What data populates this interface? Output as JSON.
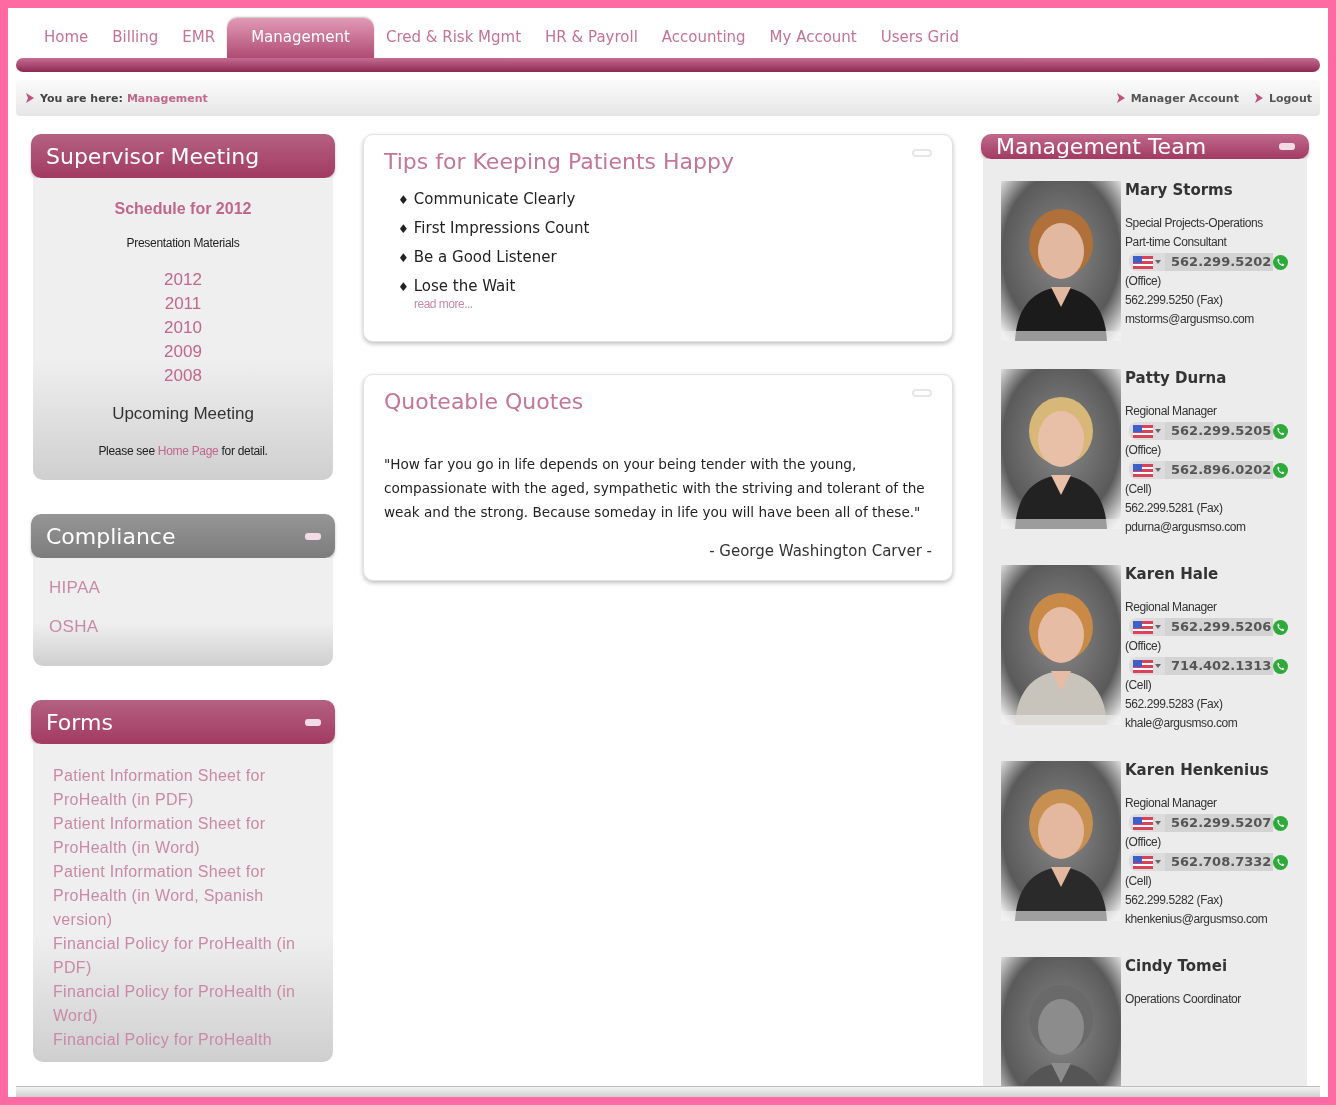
{
  "nav": {
    "tabs": [
      {
        "label": "Home",
        "selected": false
      },
      {
        "label": "Billing",
        "selected": false
      },
      {
        "label": "EMR",
        "selected": false
      },
      {
        "label": "Management",
        "selected": true
      },
      {
        "label": "Cred & Risk Mgmt",
        "selected": false
      },
      {
        "label": "HR & Payroll",
        "selected": false
      },
      {
        "label": "Accounting",
        "selected": false
      },
      {
        "label": "My Account",
        "selected": false
      },
      {
        "label": "Users Grid",
        "selected": false
      }
    ]
  },
  "breadcrumb": {
    "prefix": "You are here:",
    "current": "Management",
    "links": [
      "Manager Account",
      "Logout"
    ]
  },
  "left_panels": [
    {
      "kind": "meeting",
      "title": "Supervisor Meeting",
      "color": "#a23a62",
      "collapsible": false,
      "schedule_title": "Schedule for 2012",
      "materials_label": "Presentation Materials",
      "years": [
        "2012",
        "2011",
        "2010",
        "2009",
        "2008"
      ],
      "upcoming_title": "Upcoming Meeting",
      "detail": {
        "before": "Please see",
        "link": "Home Page",
        "after": "for detail."
      }
    },
    {
      "kind": "links",
      "title": "Compliance",
      "color": "#7c7c7c",
      "collapsible": true,
      "links": [
        "HIPAA",
        "OSHA"
      ]
    },
    {
      "kind": "links",
      "title": "Forms",
      "color": "#a23a62",
      "collapsible": true,
      "links": [
        "Patient Information Sheet for ProHealth (in PDF)",
        "Patient Information Sheet for ProHealth (in Word)",
        "Patient Information Sheet for ProHealth (in Word, Spanish version)",
        "Financial Policy for ProHealth (in PDF)",
        "Financial Policy for ProHealth (in Word)",
        "Financial Policy for ProHealth"
      ]
    }
  ],
  "cards": [
    {
      "kind": "tips",
      "title": "Tips for Keeping Patients Happy",
      "collapsible": true,
      "bullet": "♦",
      "items": [
        "Communicate Clearly",
        "First Impressions Count",
        "Be a Good Listener",
        "Lose the Wait"
      ],
      "more": "read more..."
    },
    {
      "kind": "quote",
      "title": "Quoteable Quotes",
      "collapsible": true,
      "quote": "\"How far you go in life depends on your being tender with the young, compassionate with the aged, sympathetic with the striving and tolerant of the weak and the strong.  Because someday in life you will have been all of these.\"",
      "author": "- George Washington Carver -"
    }
  ],
  "team": {
    "title": "Management Team",
    "collapsible": true,
    "members": [
      {
        "name": "Mary Storms",
        "roles": [
          "Special Projects-Operations",
          "Part-time Consultant"
        ],
        "phones": [
          {
            "number": "562.299.5202",
            "label": "(Office)"
          }
        ],
        "fax": "562.299.5250 (Fax)",
        "email": "mstorms@argusmso.com"
      },
      {
        "name": "Patty Durna",
        "roles": [
          "Regional Manager"
        ],
        "phones": [
          {
            "number": "562.299.5205",
            "label": "(Office)"
          },
          {
            "number": "562.896.0202",
            "label": "(Cell)"
          }
        ],
        "fax": "562.299.5281 (Fax)",
        "email": "pdurna@argusmso.com"
      },
      {
        "name": "Karen Hale",
        "roles": [
          "Regional Manager"
        ],
        "phones": [
          {
            "number": "562.299.5206",
            "label": "(Office)"
          },
          {
            "number": "714.402.1313",
            "label": "(Cell)"
          }
        ],
        "fax": "562.299.5283 (Fax)",
        "email": "khale@argusmso.com"
      },
      {
        "name": "Karen Henkenius",
        "roles": [
          "Regional Manager"
        ],
        "phones": [
          {
            "number": "562.299.5207",
            "label": "(Office)"
          },
          {
            "number": "562.708.7332",
            "label": "(Cell)"
          }
        ],
        "fax": "562.299.5282 (Fax)",
        "email": "khenkenius@argusmso.com"
      },
      {
        "name": "Cindy Tomei",
        "roles": [
          "Operations Coordinator"
        ]
      }
    ]
  }
}
